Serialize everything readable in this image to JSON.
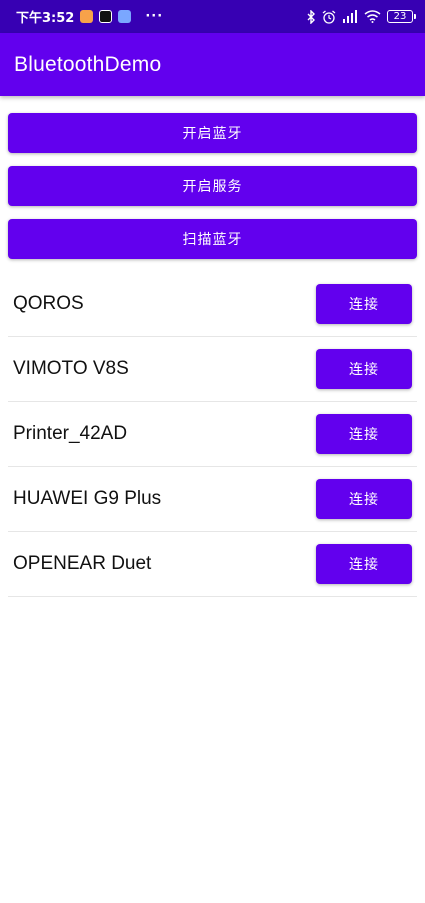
{
  "status_bar": {
    "time": "下午3:52",
    "more": "···",
    "battery": "23"
  },
  "app_bar": {
    "title": "BluetoothDemo"
  },
  "actions": {
    "enable_bluetooth": "开启蓝牙",
    "start_service": "开启服务",
    "scan_bluetooth": "扫描蓝牙"
  },
  "devices": [
    {
      "name": "QOROS",
      "button": "连接"
    },
    {
      "name": "VIMOTO V8S",
      "button": "连接"
    },
    {
      "name": "Printer_42AD",
      "button": "连接"
    },
    {
      "name": "HUAWEI G9 Plus",
      "button": "连接"
    },
    {
      "name": "OPENEAR Duet",
      "button": "连接"
    }
  ],
  "colors": {
    "status_bar": "#3700b3",
    "primary": "#6200ee"
  }
}
